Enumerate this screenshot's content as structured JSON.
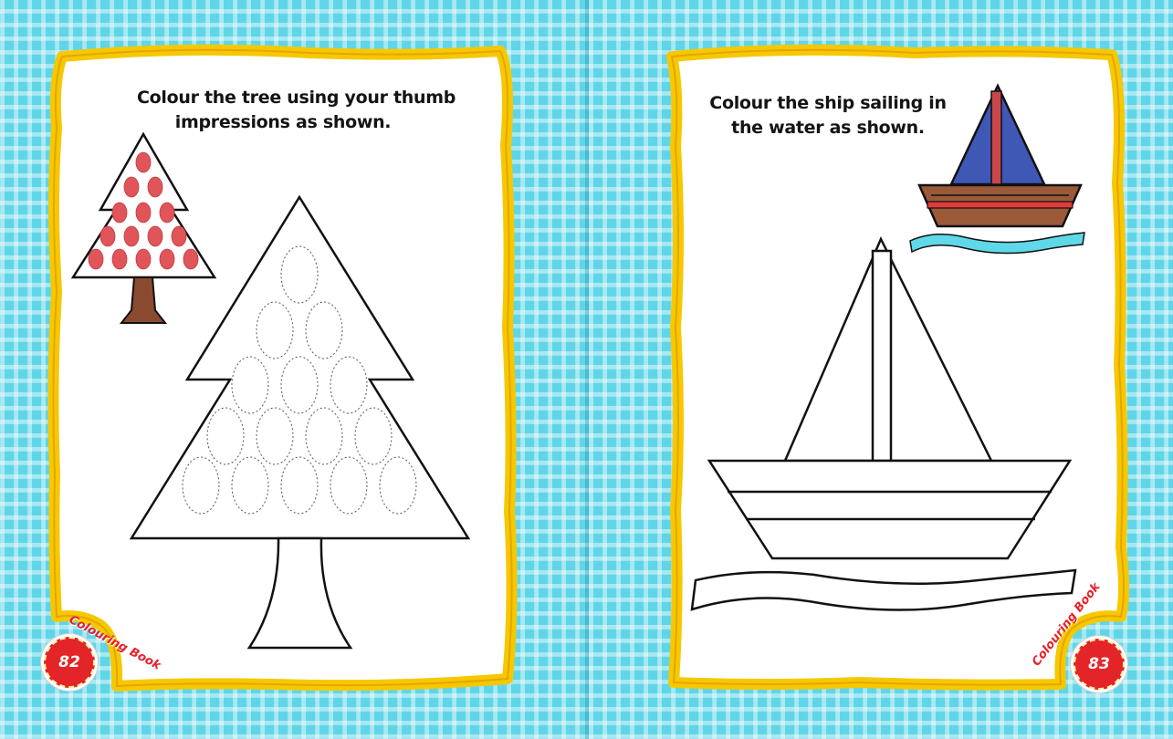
{
  "spread": {
    "left_page": {
      "instruction": [
        "Colour the tree using your thumb",
        "impressions as shown."
      ],
      "brand": "Colouring Book",
      "page_number": "82",
      "example_icon": "tree-thumbprint-example",
      "outline_icon": "tree-outline"
    },
    "right_page": {
      "instruction": [
        "Colour the ship sailing in",
        "the water as shown."
      ],
      "brand": "Colouring Book",
      "page_number": "83",
      "example_icon": "sailboat-colored-example",
      "outline_icon": "sailboat-outline"
    }
  },
  "colors": {
    "background": "#5fd6e8",
    "frame_border": "#f5c800",
    "thumbprint": "#e0555a",
    "tree_trunk": "#8a4a30",
    "sail": "#3f57b5",
    "hull": "#9a5a3a",
    "stripe": "#e23b3b",
    "water": "#5fd8e8",
    "page_badge": "#e32428"
  }
}
